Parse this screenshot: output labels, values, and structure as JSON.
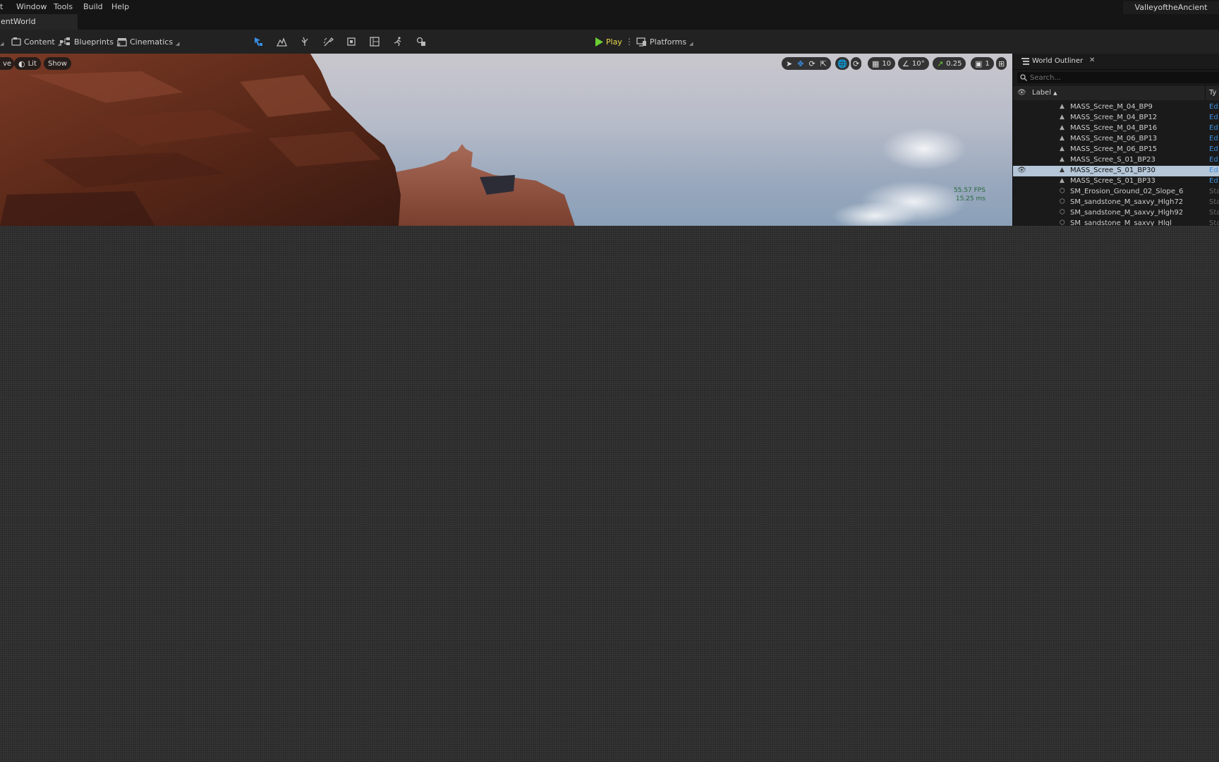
{
  "menu": [
    "t",
    "Window",
    "Tools",
    "Build",
    "Help"
  ],
  "project_name": "ValleyoftheAncient",
  "level_tab": "entWorld",
  "toolbar": {
    "left_cut_label": "",
    "content": "Content",
    "blueprints": "Blueprints",
    "cinematics": "Cinematics",
    "play": "Play",
    "platforms": "Platforms"
  },
  "viewport": {
    "perspective_cut": "ve",
    "lit": "Lit",
    "show": "Show",
    "grid_snap": "10",
    "rotation_snap": "10°",
    "scale_snap": "0.25",
    "camera_speed": "1",
    "fps": "55.57 FPS",
    "ms": "15.25 ms"
  },
  "outliner": {
    "title": "World Outliner",
    "search_placeholder": "Search...",
    "col_label": "Label",
    "col_type": "Ty",
    "rows": [
      {
        "label": "MASS_Scree_M_04_BP9",
        "type": "Ed"
      },
      {
        "label": "MASS_Scree_M_04_BP12",
        "type": "Ed"
      },
      {
        "label": "MASS_Scree_M_04_BP16",
        "type": "Ed"
      },
      {
        "label": "MASS_Scree_M_06_BP13",
        "type": "Ed"
      },
      {
        "label": "MASS_Scree_M_06_BP15",
        "type": "Ed"
      },
      {
        "label": "MASS_Scree_S_01_BP23",
        "type": "Ed"
      },
      {
        "label": "MASS_Scree_S_01_BP30",
        "type": "Ed"
      },
      {
        "label": "MASS_Scree_S_01_BP33",
        "type": "Ed"
      },
      {
        "label": "SM_Erosion_Ground_02_Slope_6",
        "type": "Sta"
      },
      {
        "label": "SM_sandstone_M_saxvy_Hlgh72",
        "type": "Sta"
      },
      {
        "label": "SM_sandstone_M_saxvy_Hlgh92",
        "type": "Sta"
      },
      {
        "label": "SM_sandstone_M_saxvy_Hlgl",
        "type": "Sta"
      }
    ],
    "selected_index": 6
  }
}
